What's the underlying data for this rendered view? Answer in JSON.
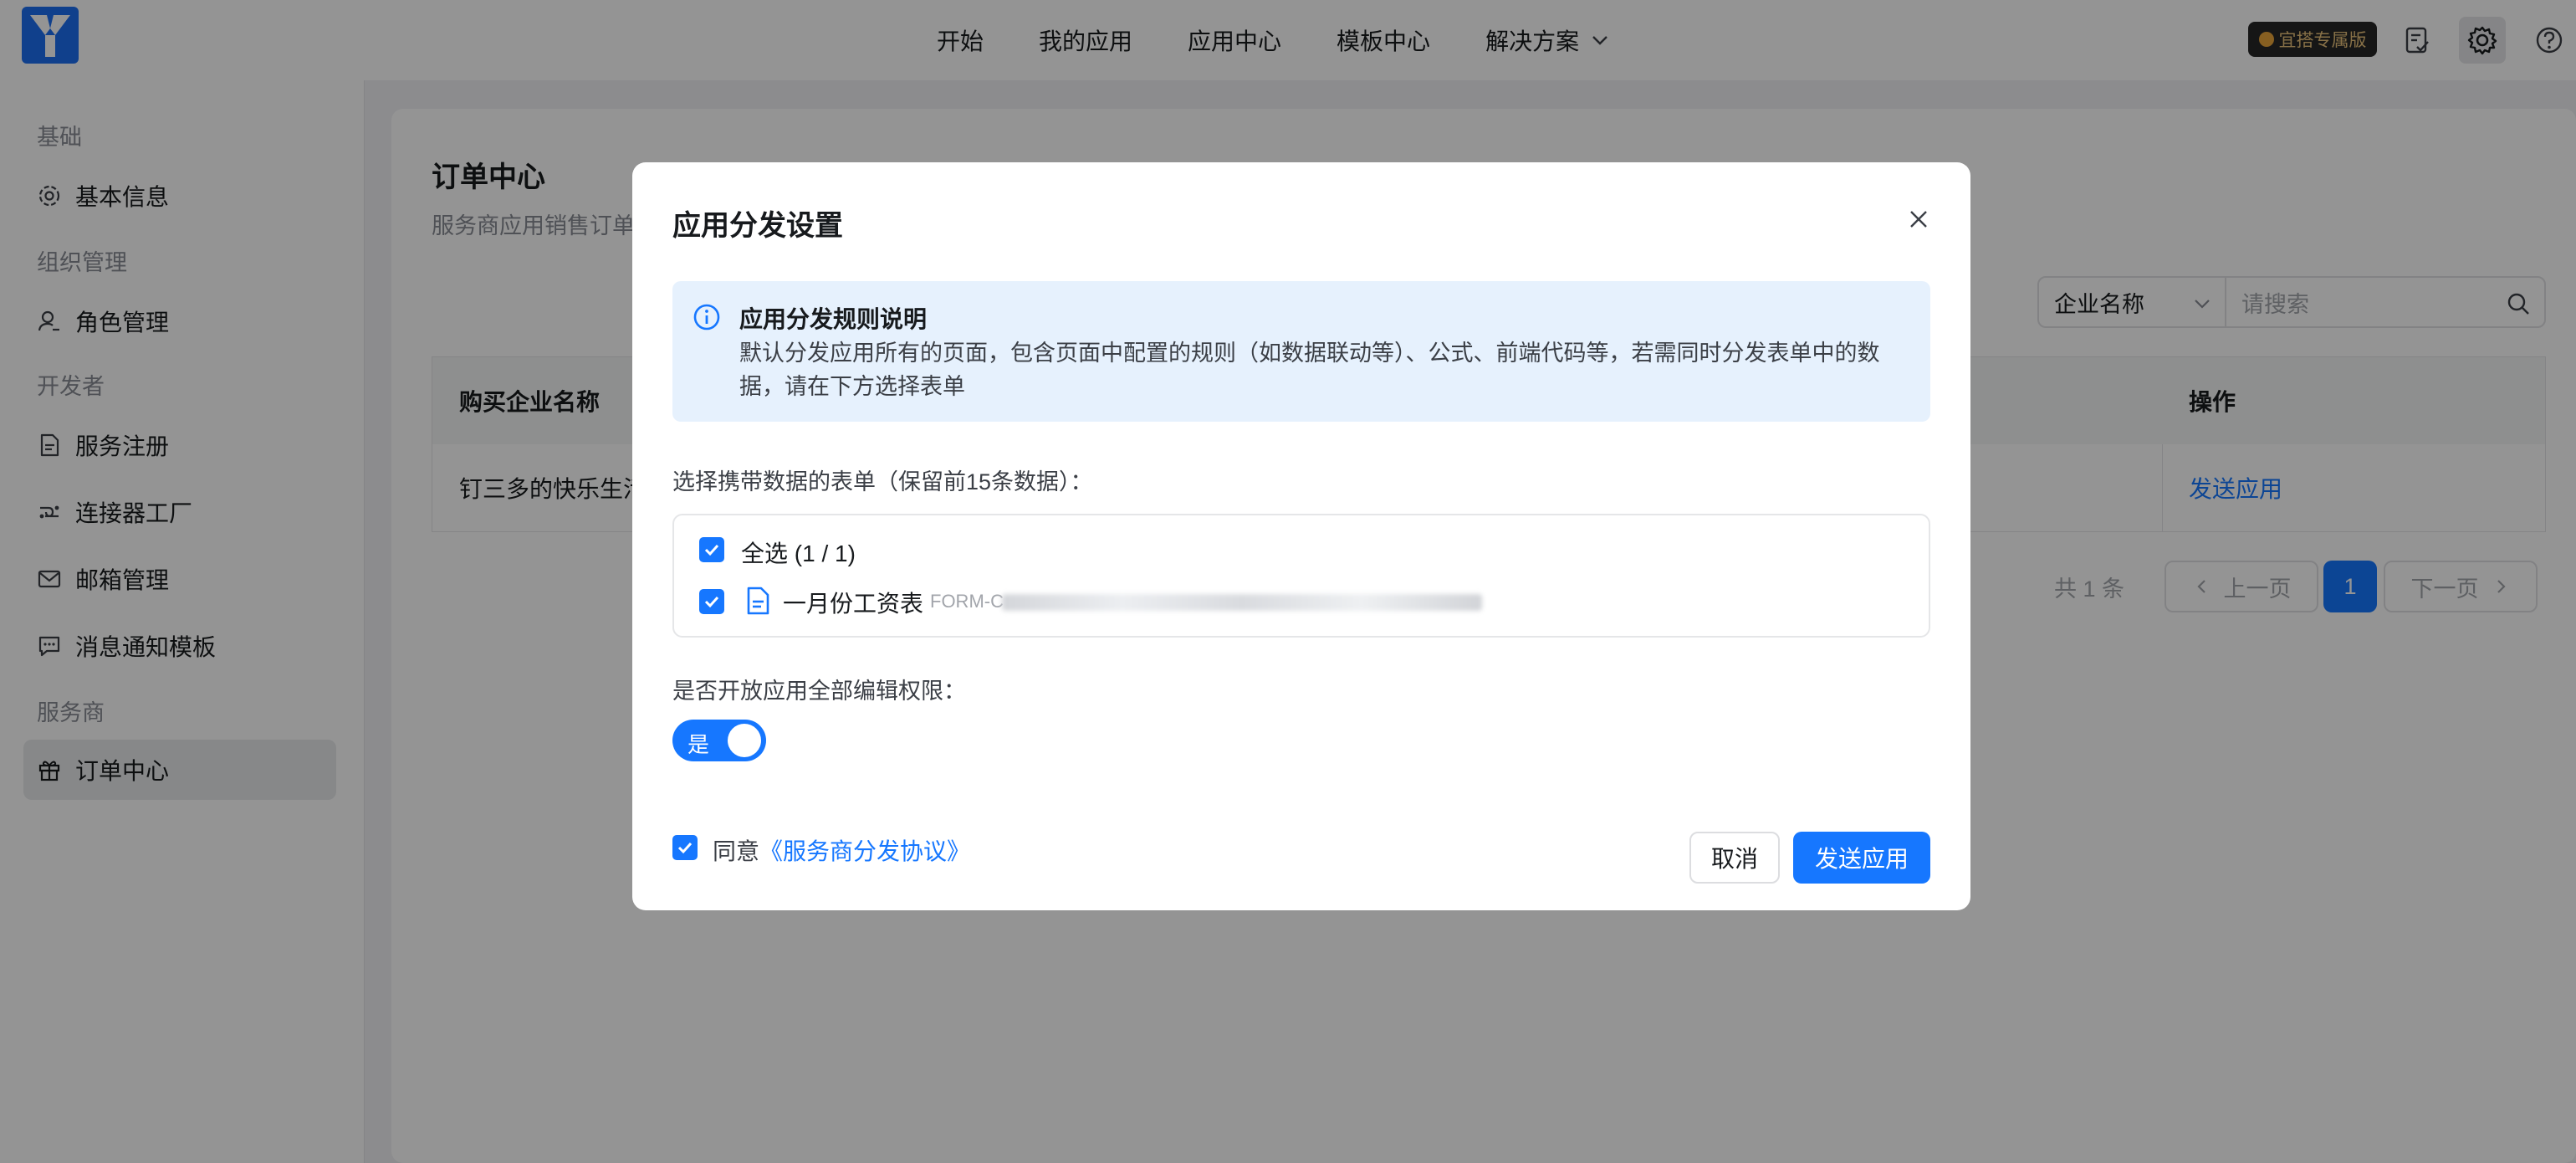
{
  "colors": {
    "primary": "#1677ff",
    "badge_bg": "#262626",
    "badge_text": "#e8c27a",
    "notice_bg": "#e6f1fd"
  },
  "topbar": {
    "nav": [
      {
        "label": "开始"
      },
      {
        "label": "我的应用"
      },
      {
        "label": "应用中心"
      },
      {
        "label": "模板中心"
      },
      {
        "label": "解决方案"
      }
    ],
    "badge": "宜搭专属版",
    "icons": [
      "logo-icon",
      "todo-check-icon",
      "settings-gear-icon",
      "help-icon"
    ]
  },
  "sidebar": {
    "groups": [
      "基础",
      "组织管理",
      "开发者",
      "服务商"
    ],
    "items": [
      {
        "label": "基本信息",
        "icon": "gear-icon"
      },
      {
        "label": "角色管理",
        "icon": "user-role-icon"
      },
      {
        "label": "服务注册",
        "icon": "document-icon"
      },
      {
        "label": "连接器工厂",
        "icon": "connector-icon"
      },
      {
        "label": "邮箱管理",
        "icon": "mail-icon"
      },
      {
        "label": "消息通知模板",
        "icon": "message-icon"
      },
      {
        "label": "订单中心",
        "icon": "gift-icon",
        "active": true
      }
    ]
  },
  "main": {
    "title": "订单中心",
    "description": "服务商应用销售订单",
    "filter": {
      "select_value": "企业名称",
      "search_placeholder": "请搜索"
    },
    "table": {
      "headers": [
        "购买企业名称",
        "操作"
      ],
      "rows": [
        {
          "company": "钉三多的快乐生活",
          "action": "发送应用"
        }
      ]
    },
    "pagination": {
      "total": "共 1 条",
      "prev": "上一页",
      "current": "1",
      "next": "下一页"
    }
  },
  "modal": {
    "title": "应用分发设置",
    "notice": {
      "title": "应用分发规则说明",
      "body": "默认分发应用所有的页面，包含页面中配置的规则（如数据联动等）、公式、前端代码等，若需同时分发表单中的数据，请在下方选择表单"
    },
    "form_select_label": "选择携带数据的表单（保留前15条数据）：",
    "select_all_label": "全选 (1 / 1)",
    "forms": [
      {
        "name": "一月份工资表",
        "code": "FORM-C",
        "checked": true
      }
    ],
    "permission_label": "是否开放应用全部编辑权限：",
    "toggle": {
      "label": "是",
      "on": true
    },
    "agree": {
      "prefix": "同意",
      "link": "《服务商分发协议》",
      "checked": true
    },
    "buttons": {
      "cancel": "取消",
      "submit": "发送应用"
    }
  }
}
